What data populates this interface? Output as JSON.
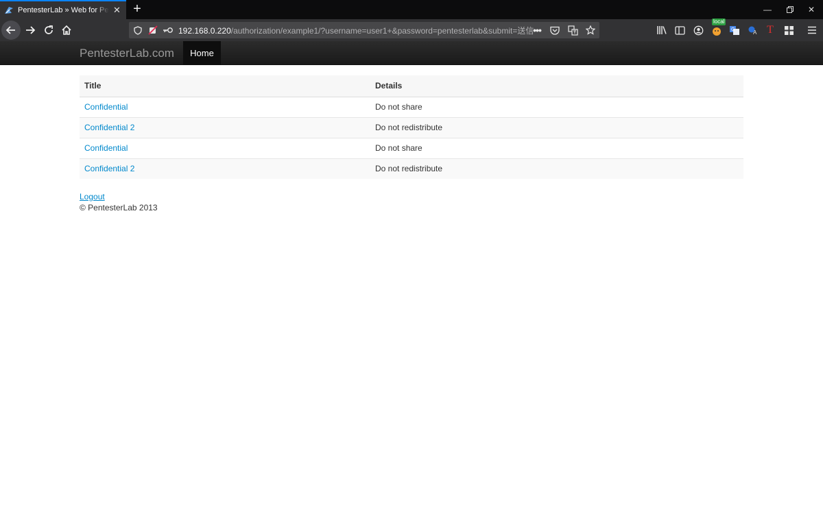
{
  "browser": {
    "tab_title": "PentesterLab » Web for Pentester",
    "url_host": "192.168.0.220",
    "url_path": "/authorization/example1/?username=user1+&password=pentesterlab&submit=送信",
    "badge_local": "local",
    "icons": {
      "tab_favicon": "pentesterlab-logo-icon",
      "tab_close": "close-icon",
      "new_tab": "plus-icon",
      "minimize": "minimize-icon",
      "restore": "restore-icon",
      "close_window": "close-icon",
      "back": "arrow-left-icon",
      "forward": "arrow-right-icon",
      "reload": "reload-icon",
      "home": "home-icon",
      "shield": "shield-icon",
      "permissions": "blocked-permission-icon",
      "key": "key-icon",
      "page_actions": "ellipsis-icon",
      "pocket": "pocket-icon",
      "translate": "translate-icon",
      "bookmark": "star-icon",
      "library": "library-icon",
      "sidebar": "sidebar-icon",
      "account": "account-icon",
      "menu": "hamburger-icon"
    }
  },
  "site": {
    "brand": "PentesterLab.com",
    "nav_home": "Home"
  },
  "table": {
    "headers": [
      "Title",
      "Details"
    ],
    "rows": [
      {
        "title": "Confidential",
        "details": "Do not share"
      },
      {
        "title": "Confidential 2",
        "details": "Do not redistribute"
      },
      {
        "title": "Confidential",
        "details": "Do not share"
      },
      {
        "title": "Confidential 2",
        "details": "Do not redistribute"
      }
    ]
  },
  "footer": {
    "logout": "Logout",
    "copyright": "© PentesterLab 2013"
  },
  "colors": {
    "link": "#0088cc",
    "navbar": "#1b1b1b",
    "browser_accent": "#0a84ff"
  }
}
